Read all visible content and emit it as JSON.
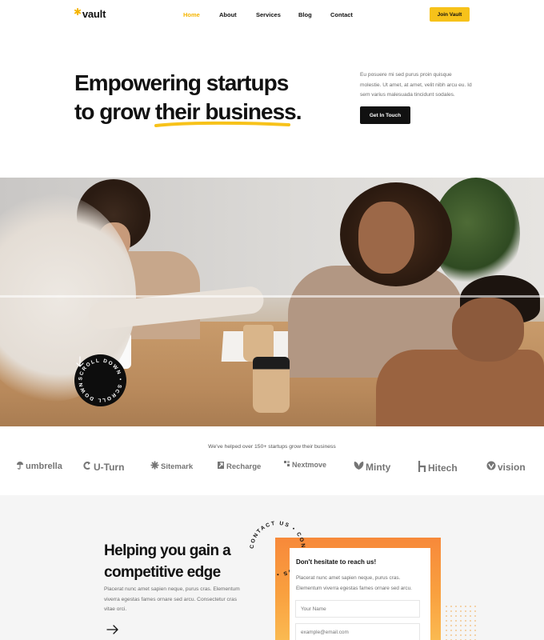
{
  "nav": {
    "logo": "vault",
    "links": [
      {
        "label": "Home",
        "active": true
      },
      {
        "label": "About",
        "active": false
      },
      {
        "label": "Services",
        "active": false
      },
      {
        "label": "Blog",
        "active": false
      },
      {
        "label": "Contact",
        "active": false
      }
    ],
    "join_label": "Join Vault"
  },
  "hero": {
    "title_line1": "Empowering startups",
    "title_line2_prefix": "to grow ",
    "title_line2_highlight": "their business",
    "title_line2_suffix": ".",
    "description": "Eu posuere mi sed purus proin quisque molestie. Ut amet, at amet, velit nibh arcu eu. Id sem varius malesuada tincidunt sodales.",
    "cta_label": "Get In Touch"
  },
  "scroll_badge": {
    "text": "SCROLL DOWN • SCROLL DOWN • "
  },
  "brands": {
    "heading": "We've helped over 150+ startups grow their business",
    "items": [
      {
        "name": "umbrella",
        "icon": "umbrella-icon"
      },
      {
        "name": "U-Turn",
        "icon": "u-turn-icon"
      },
      {
        "name": "Sitemark",
        "icon": "sitemark-icon"
      },
      {
        "name": "Recharge",
        "icon": "recharge-icon"
      },
      {
        "name": "Nextmove",
        "icon": "nextmove-icon"
      },
      {
        "name": "Minty",
        "icon": "minty-icon"
      },
      {
        "name": "Hitech",
        "icon": "hitech-icon"
      },
      {
        "name": "vision",
        "icon": "vision-icon"
      }
    ]
  },
  "help": {
    "title_line1": "Helping you gain a",
    "title_line2": "competitive edge",
    "description": "Placerat nunc amet sapien neque, purus cras. Elementum viverra egestas fames ornare sed arcu. Consectetur cras vitae orci."
  },
  "contact_ring": {
    "text": "CONTACT US • CONTACT US • "
  },
  "form": {
    "title": "Don't hesitate to reach us!",
    "description": "Placerat nunc amet sapien neque, purus cras. Elementum viverra egestas fames ornare sed arcu.",
    "name_placeholder": "Your Name",
    "email_placeholder": "example@email.com"
  },
  "colors": {
    "accent": "#f7c21a",
    "orange": "#f7893a",
    "dark": "#111111"
  }
}
